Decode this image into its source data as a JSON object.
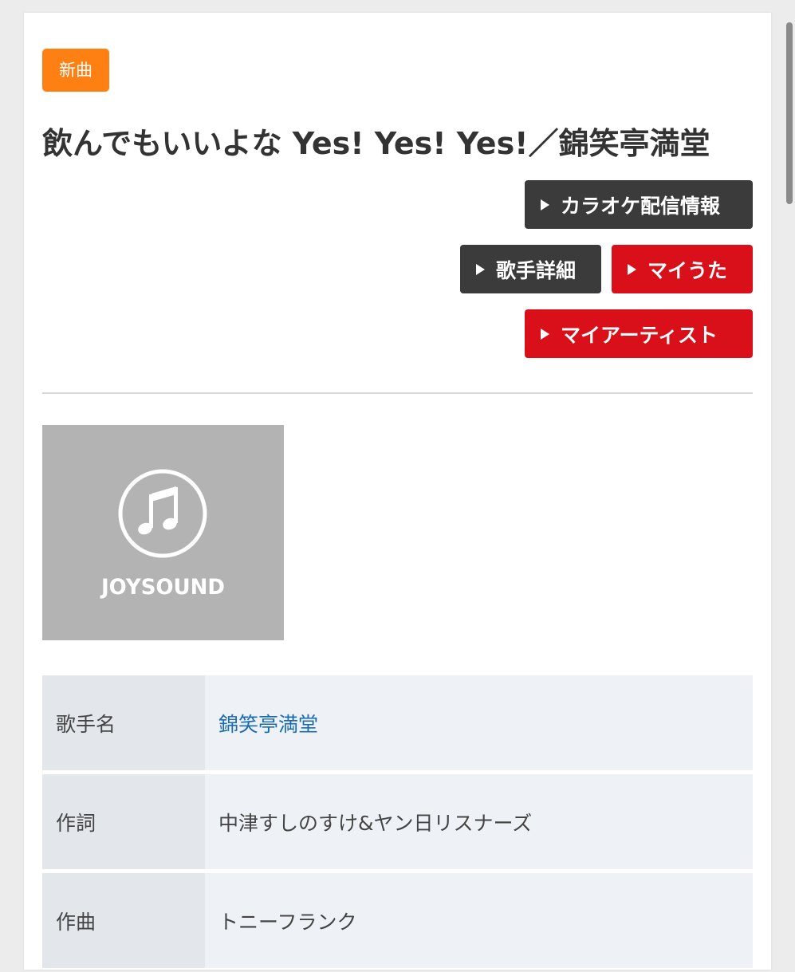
{
  "badge": {
    "label": "新曲",
    "color": "#ff8012"
  },
  "song": {
    "title": "飲んでもいいよな Yes! Yes! Yes!／錦笑亭満堂"
  },
  "buttons": {
    "karaoke_info": "カラオケ配信情報",
    "artist_detail": "歌手詳細",
    "my_uta": "マイうた",
    "my_artist": "マイアーティスト"
  },
  "colors": {
    "dark_button": "#3b3b3b",
    "red_button": "#d9101a",
    "link": "#1a6bb0"
  },
  "jacket": {
    "icon": "music-note-icon",
    "logo_text": "JOYSOUND"
  },
  "info": {
    "rows": [
      {
        "key": "歌手名",
        "value": "錦笑亭満堂"
      },
      {
        "key": "作詞",
        "value": "中津すしのすけ&ヤン日リスナーズ"
      },
      {
        "key": "作曲",
        "value": "トニーフランク"
      }
    ]
  }
}
